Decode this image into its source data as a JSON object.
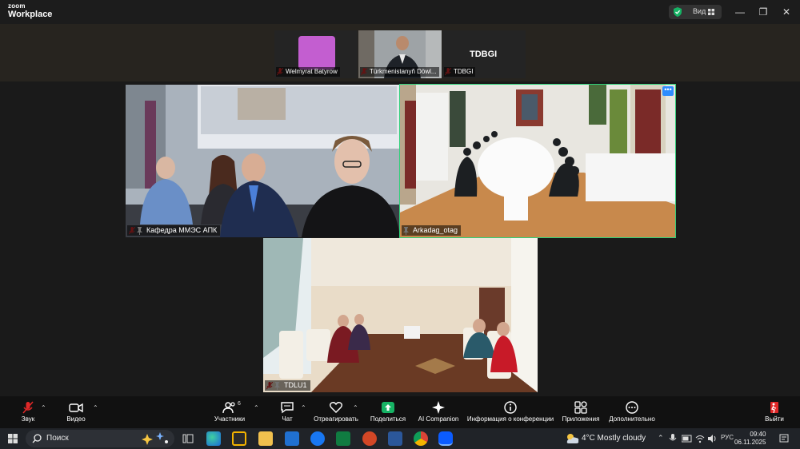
{
  "app": {
    "logo_line1": "zoom",
    "logo_line2": "Workplace",
    "view_label": "Вид"
  },
  "strip": {
    "tiles": [
      {
        "name": "Welmyrat Batyrow"
      },
      {
        "name": "Türkmenistanyň Döwl..."
      },
      {
        "name": "TDBGI",
        "center_text": "TDBGI"
      }
    ]
  },
  "gallery": {
    "tiles": [
      {
        "name": "Кафедра ММЭС АПК"
      },
      {
        "name": "Arkadag_otag"
      },
      {
        "name": "TDLU1"
      }
    ]
  },
  "toolbar": {
    "audio": "Звук",
    "video": "Видео",
    "participants": "Участники",
    "participants_count": "6",
    "chat": "Чат",
    "react": "Отреагировать",
    "share": "Поделиться",
    "ai": "AI Companion",
    "info": "Информация о конференции",
    "apps": "Приложения",
    "more": "Дополнительно",
    "leave": "Выйти"
  },
  "taskbar": {
    "search_placeholder": "Поиск",
    "weather": "4°C  Mostly cloudy",
    "lang": "РУС",
    "time": "09:40",
    "date": "06.11.2025"
  },
  "colors": {
    "active_border": "#30d07a",
    "zoom_blue": "#2d8cff",
    "share_green": "#16b364",
    "avatar_purple": "#c35ed0"
  }
}
